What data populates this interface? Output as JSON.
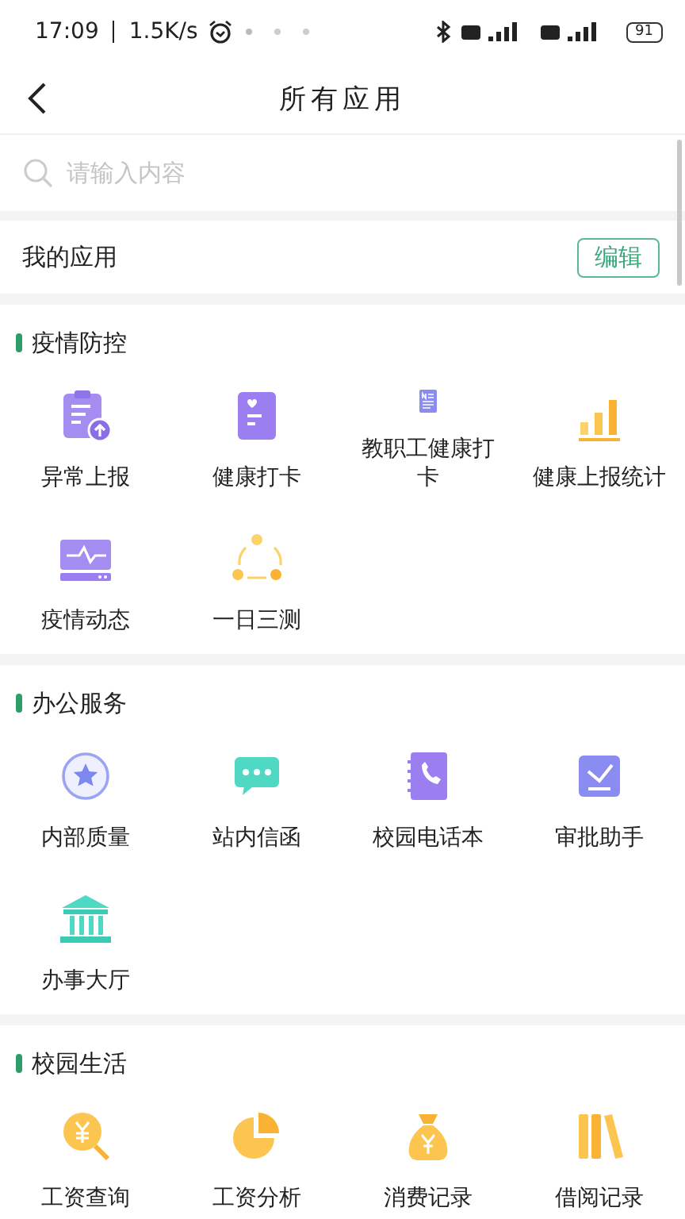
{
  "status_bar": {
    "time": "17:09",
    "speed": "1.5K/s",
    "battery": "91"
  },
  "header": {
    "title": "所有应用"
  },
  "search": {
    "placeholder": "请输入内容"
  },
  "my_apps": {
    "title": "我的应用",
    "edit_button": "编辑"
  },
  "sections": [
    {
      "title": "疫情防控",
      "apps": [
        "异常上报",
        "健康打卡",
        "教职工健康打卡",
        "健康上报统计",
        "疫情动态",
        "一日三测"
      ]
    },
    {
      "title": "办公服务",
      "apps": [
        "内部质量",
        "站内信函",
        "校园电话本",
        "审批助手",
        "办事大厅"
      ]
    },
    {
      "title": "校园生活",
      "apps": [
        "工资查询",
        "工资分析",
        "消费记录",
        "借阅记录"
      ]
    }
  ]
}
